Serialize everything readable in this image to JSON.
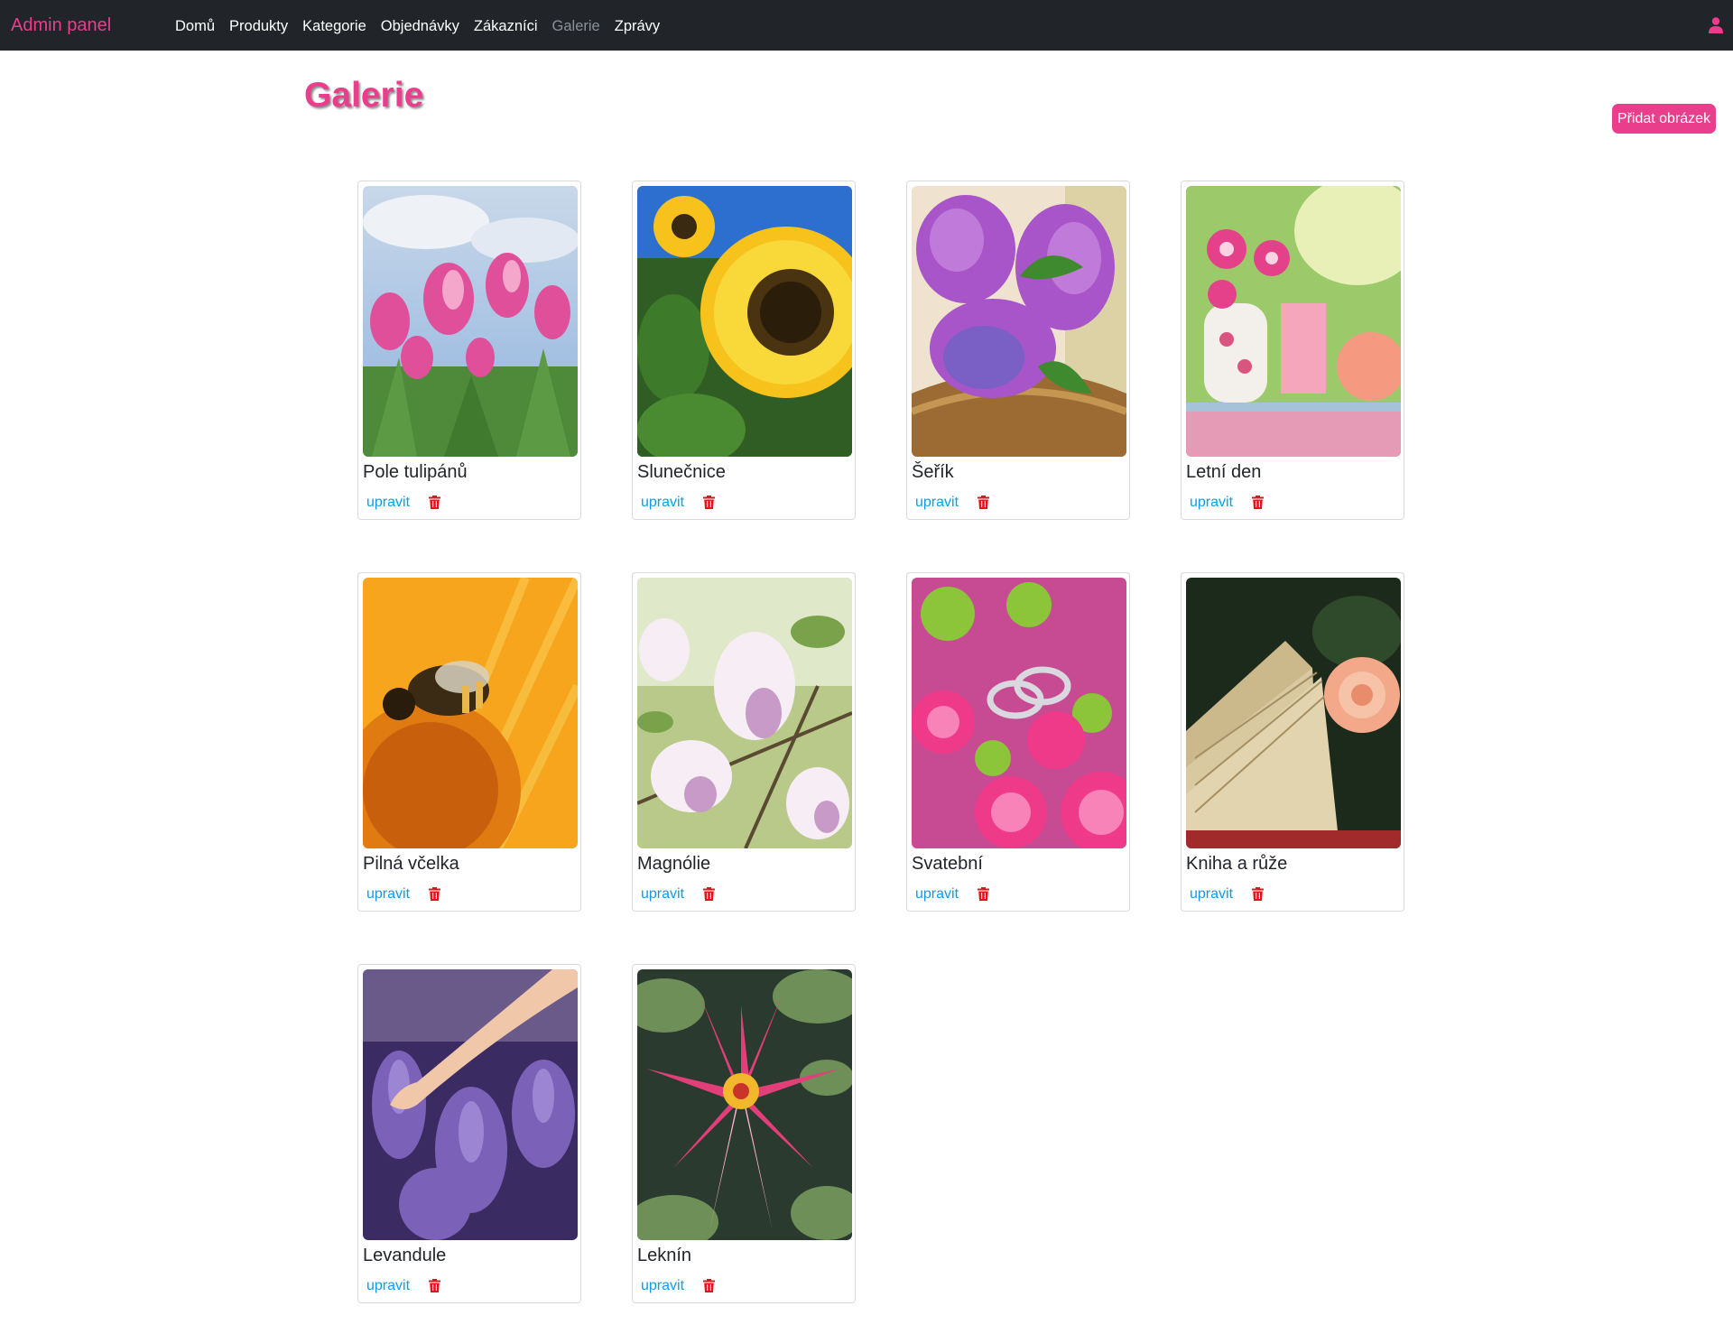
{
  "navbar": {
    "brand": "Admin panel",
    "links": [
      {
        "label": "Domů",
        "active": false
      },
      {
        "label": "Produkty",
        "active": false
      },
      {
        "label": "Kategorie",
        "active": false
      },
      {
        "label": "Objednávky",
        "active": false
      },
      {
        "label": "Zákazníci",
        "active": false
      },
      {
        "label": "Galerie",
        "active": true
      },
      {
        "label": "Zprávy",
        "active": false
      }
    ],
    "user_icon": "user-icon"
  },
  "page": {
    "title": "Galerie",
    "add_button": "Přidat obrázek"
  },
  "gallery": {
    "edit_label": "upravit",
    "delete_icon": "trash-icon",
    "items": [
      {
        "title": "Pole tulipánů",
        "image": "pink tulips"
      },
      {
        "title": "Slunečnice",
        "image": "sunflowers"
      },
      {
        "title": "Šeřík",
        "image": "lilac in basket"
      },
      {
        "title": "Letní den",
        "image": "pink flowers and lemonade"
      },
      {
        "title": "Pilná včelka",
        "image": "bee on yellow flower"
      },
      {
        "title": "Magnólie",
        "image": "magnolia blossoms"
      },
      {
        "title": "Svatební",
        "image": "wedding rings on roses"
      },
      {
        "title": "Kniha a růže",
        "image": "book and rose"
      },
      {
        "title": "Levandule",
        "image": "lavender field with hand"
      },
      {
        "title": "Leknín",
        "image": "water lily"
      }
    ]
  },
  "colors": {
    "accent": "#e83e8c",
    "navbar_bg": "#212529",
    "link": "#0d9de8",
    "danger": "#dc3545"
  }
}
